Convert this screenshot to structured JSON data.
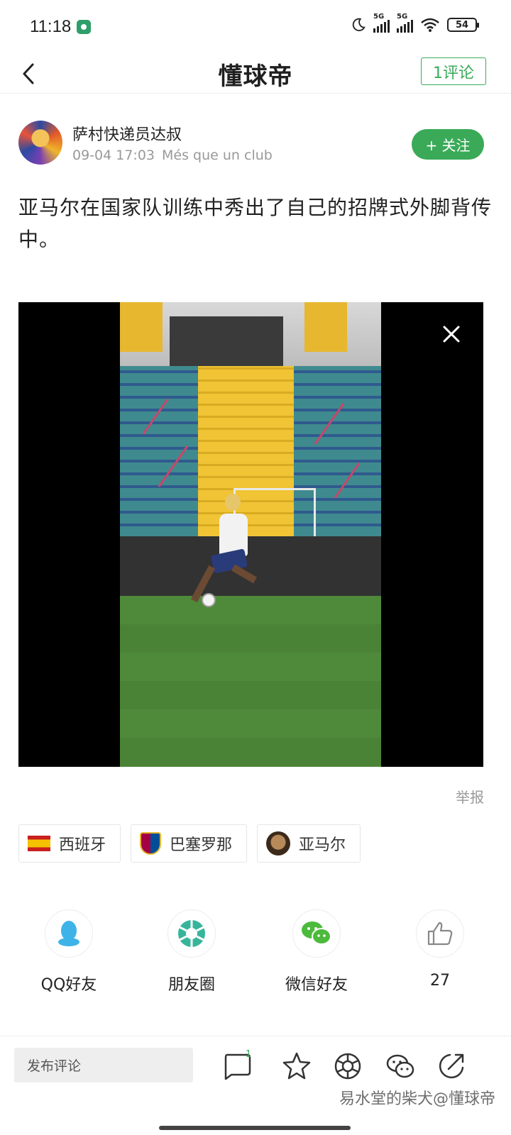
{
  "status_bar": {
    "time": "11:18",
    "network_1": "5G",
    "network_2": "5G",
    "battery": "54"
  },
  "header": {
    "logo": "懂球帝",
    "comment_button": "1评论"
  },
  "post": {
    "author": "萨村快递员达叔",
    "date": "09-04 17:03",
    "source": "Més que un club",
    "follow_label": "+ 关注",
    "text": "亚马尔在国家队训练中秀出了自己的招牌式外脚背传中。",
    "report_label": "举报"
  },
  "tags": [
    {
      "label": "西班牙",
      "icon": "spain-flag"
    },
    {
      "label": "巴塞罗那",
      "icon": "barcelona-crest"
    },
    {
      "label": "亚马尔",
      "icon": "player-avatar"
    }
  ],
  "share": [
    {
      "label": "QQ好友",
      "icon": "qq-icon"
    },
    {
      "label": "朋友圈",
      "icon": "moments-icon"
    },
    {
      "label": "微信好友",
      "icon": "wechat-icon"
    },
    {
      "label": "27",
      "icon": "thumbs-up-icon"
    }
  ],
  "bottom_bar": {
    "comment_placeholder": "发布评论",
    "comment_badge": "1",
    "watermark": "易水堂的柴犬@懂球帝"
  },
  "colors": {
    "accent_green": "#3aaa58",
    "muted_text": "#999999"
  }
}
